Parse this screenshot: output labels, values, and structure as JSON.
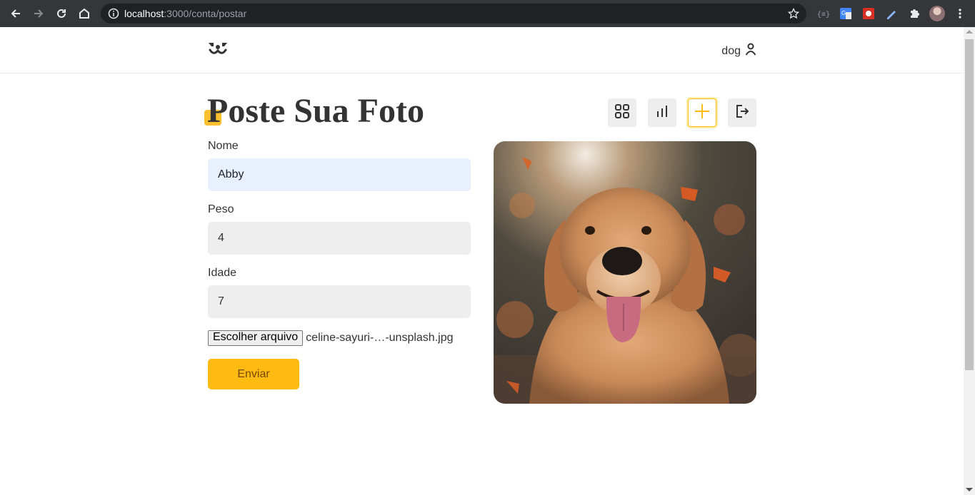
{
  "browser": {
    "url_host": "localhost",
    "url_path": ":3000/conta/postar"
  },
  "header": {
    "username": "dog"
  },
  "page": {
    "title": "Poste Sua Foto"
  },
  "form": {
    "nome_label": "Nome",
    "nome_value": "Abby",
    "peso_label": "Peso",
    "peso_value": "4",
    "idade_label": "Idade",
    "idade_value": "7",
    "file_button": "Escolher arquivo",
    "file_name": "celine-sayuri-…-unsplash.jpg",
    "submit_label": "Enviar"
  },
  "colors": {
    "accent": "#ffbb11",
    "title": "#333333",
    "autofill_bg": "#e8f0fe",
    "input_bg": "#eeeeee"
  },
  "icons": [
    "back-icon",
    "forward-icon",
    "reload-icon",
    "home-icon",
    "site-info-icon",
    "bookmark-star-icon",
    "extensions-icon",
    "dog-logo-icon",
    "user-icon",
    "feed-grid-icon",
    "stats-icon",
    "add-photo-icon",
    "logout-icon"
  ]
}
